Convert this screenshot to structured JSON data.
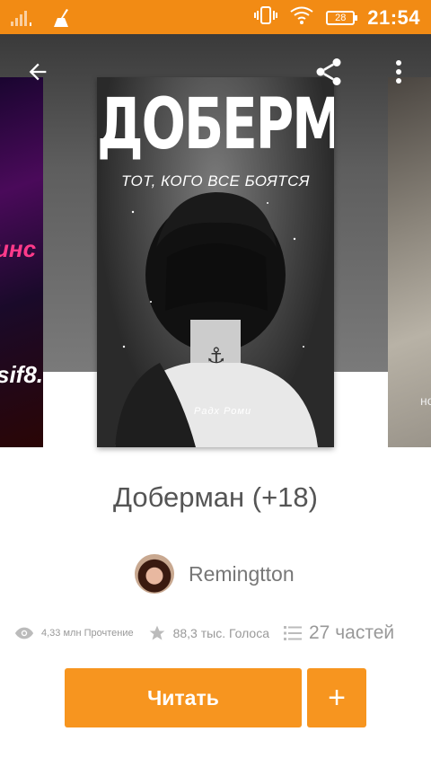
{
  "status_bar": {
    "time": "21:54",
    "battery": "28",
    "bg_color": "#f28b14"
  },
  "toolbar": {
    "back_icon": "arrow-left-icon",
    "share_icon": "share-icon",
    "menu_icon": "more-vert-icon"
  },
  "cover": {
    "title": "ДОБЕРМАН",
    "subtitle": "ТОТ, КОГО ВСЕ БОЯТСЯ",
    "signature": "Радх Роми"
  },
  "side_covers": {
    "left_text_1": "инс",
    "left_text_2": "sif8.",
    "right_text": "но"
  },
  "book": {
    "title": "Доберман (+18)",
    "author": "Remingtton"
  },
  "stats": {
    "reads": "4,33 млн Прочтение",
    "votes": "88,3 тыс. Голоса",
    "parts": "27 частей"
  },
  "actions": {
    "read_label": "Читать",
    "add_label": "+",
    "accent_color": "#f7951f"
  }
}
